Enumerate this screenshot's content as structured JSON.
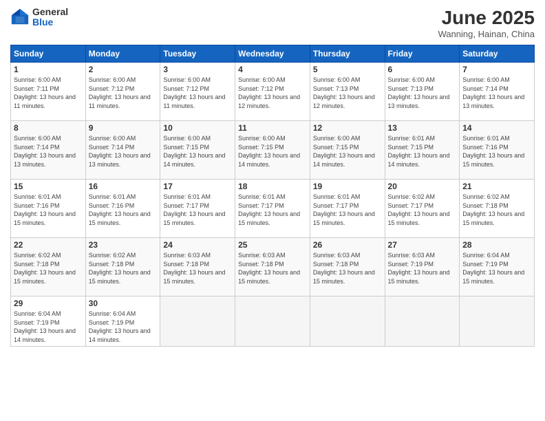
{
  "logo": {
    "general": "General",
    "blue": "Blue"
  },
  "title": "June 2025",
  "subtitle": "Wanning, Hainan, China",
  "days_header": [
    "Sunday",
    "Monday",
    "Tuesday",
    "Wednesday",
    "Thursday",
    "Friday",
    "Saturday"
  ],
  "weeks": [
    [
      {
        "num": "1",
        "sunrise": "6:00 AM",
        "sunset": "7:11 PM",
        "daylight": "13 hours and 11 minutes."
      },
      {
        "num": "2",
        "sunrise": "6:00 AM",
        "sunset": "7:12 PM",
        "daylight": "13 hours and 11 minutes."
      },
      {
        "num": "3",
        "sunrise": "6:00 AM",
        "sunset": "7:12 PM",
        "daylight": "13 hours and 11 minutes."
      },
      {
        "num": "4",
        "sunrise": "6:00 AM",
        "sunset": "7:12 PM",
        "daylight": "13 hours and 12 minutes."
      },
      {
        "num": "5",
        "sunrise": "6:00 AM",
        "sunset": "7:13 PM",
        "daylight": "13 hours and 12 minutes."
      },
      {
        "num": "6",
        "sunrise": "6:00 AM",
        "sunset": "7:13 PM",
        "daylight": "13 hours and 13 minutes."
      },
      {
        "num": "7",
        "sunrise": "6:00 AM",
        "sunset": "7:14 PM",
        "daylight": "13 hours and 13 minutes."
      }
    ],
    [
      {
        "num": "8",
        "sunrise": "6:00 AM",
        "sunset": "7:14 PM",
        "daylight": "13 hours and 13 minutes."
      },
      {
        "num": "9",
        "sunrise": "6:00 AM",
        "sunset": "7:14 PM",
        "daylight": "13 hours and 13 minutes."
      },
      {
        "num": "10",
        "sunrise": "6:00 AM",
        "sunset": "7:15 PM",
        "daylight": "13 hours and 14 minutes."
      },
      {
        "num": "11",
        "sunrise": "6:00 AM",
        "sunset": "7:15 PM",
        "daylight": "13 hours and 14 minutes."
      },
      {
        "num": "12",
        "sunrise": "6:00 AM",
        "sunset": "7:15 PM",
        "daylight": "13 hours and 14 minutes."
      },
      {
        "num": "13",
        "sunrise": "6:01 AM",
        "sunset": "7:15 PM",
        "daylight": "13 hours and 14 minutes."
      },
      {
        "num": "14",
        "sunrise": "6:01 AM",
        "sunset": "7:16 PM",
        "daylight": "13 hours and 15 minutes."
      }
    ],
    [
      {
        "num": "15",
        "sunrise": "6:01 AM",
        "sunset": "7:16 PM",
        "daylight": "13 hours and 15 minutes."
      },
      {
        "num": "16",
        "sunrise": "6:01 AM",
        "sunset": "7:16 PM",
        "daylight": "13 hours and 15 minutes."
      },
      {
        "num": "17",
        "sunrise": "6:01 AM",
        "sunset": "7:17 PM",
        "daylight": "13 hours and 15 minutes."
      },
      {
        "num": "18",
        "sunrise": "6:01 AM",
        "sunset": "7:17 PM",
        "daylight": "13 hours and 15 minutes."
      },
      {
        "num": "19",
        "sunrise": "6:01 AM",
        "sunset": "7:17 PM",
        "daylight": "13 hours and 15 minutes."
      },
      {
        "num": "20",
        "sunrise": "6:02 AM",
        "sunset": "7:17 PM",
        "daylight": "13 hours and 15 minutes."
      },
      {
        "num": "21",
        "sunrise": "6:02 AM",
        "sunset": "7:18 PM",
        "daylight": "13 hours and 15 minutes."
      }
    ],
    [
      {
        "num": "22",
        "sunrise": "6:02 AM",
        "sunset": "7:18 PM",
        "daylight": "13 hours and 15 minutes."
      },
      {
        "num": "23",
        "sunrise": "6:02 AM",
        "sunset": "7:18 PM",
        "daylight": "13 hours and 15 minutes."
      },
      {
        "num": "24",
        "sunrise": "6:03 AM",
        "sunset": "7:18 PM",
        "daylight": "13 hours and 15 minutes."
      },
      {
        "num": "25",
        "sunrise": "6:03 AM",
        "sunset": "7:18 PM",
        "daylight": "13 hours and 15 minutes."
      },
      {
        "num": "26",
        "sunrise": "6:03 AM",
        "sunset": "7:18 PM",
        "daylight": "13 hours and 15 minutes."
      },
      {
        "num": "27",
        "sunrise": "6:03 AM",
        "sunset": "7:19 PM",
        "daylight": "13 hours and 15 minutes."
      },
      {
        "num": "28",
        "sunrise": "6:04 AM",
        "sunset": "7:19 PM",
        "daylight": "13 hours and 15 minutes."
      }
    ],
    [
      {
        "num": "29",
        "sunrise": "6:04 AM",
        "sunset": "7:19 PM",
        "daylight": "13 hours and 14 minutes."
      },
      {
        "num": "30",
        "sunrise": "6:04 AM",
        "sunset": "7:19 PM",
        "daylight": "13 hours and 14 minutes."
      },
      null,
      null,
      null,
      null,
      null
    ]
  ]
}
